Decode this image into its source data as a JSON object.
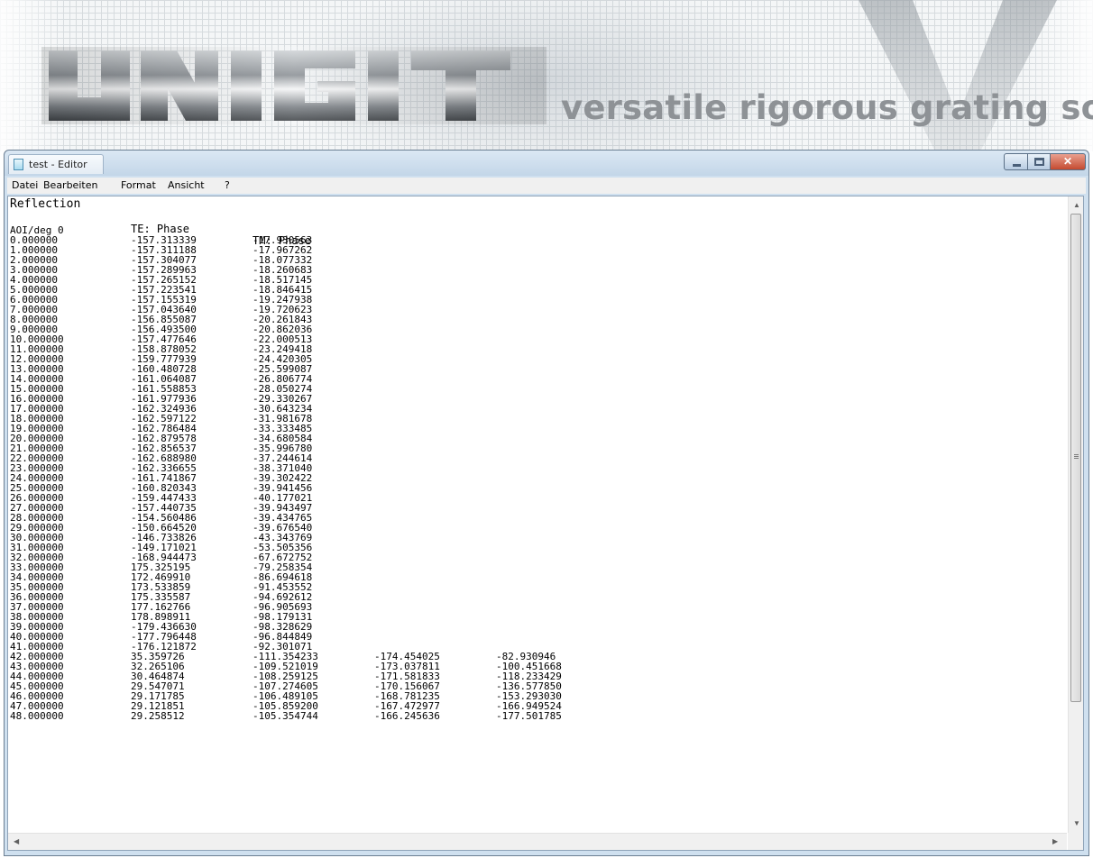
{
  "banner": {
    "logo_text": "UNIGIT",
    "tagline": "versatile rigorous grating solver"
  },
  "window": {
    "title": "test - Editor",
    "app_icon": "notepad-icon",
    "controls": {
      "minimize_icon": "minimize-icon",
      "maximize_icon": "maximize-icon",
      "close_icon": "close-icon"
    }
  },
  "menu": {
    "items": [
      "Datei",
      "Bearbeiten",
      "Format",
      "Ansicht",
      "?"
    ]
  },
  "document": {
    "title_line": "Reflection",
    "header": [
      "",
      "TE: Phase",
      "TM: Phase"
    ],
    "subheader": "AOI/deg 0",
    "rows": [
      [
        "0.000000",
        "-157.313339",
        "-17.930563"
      ],
      [
        "1.000000",
        "-157.311188",
        "-17.967262"
      ],
      [
        "2.000000",
        "-157.304077",
        "-18.077332"
      ],
      [
        "3.000000",
        "-157.289963",
        "-18.260683"
      ],
      [
        "4.000000",
        "-157.265152",
        "-18.517145"
      ],
      [
        "5.000000",
        "-157.223541",
        "-18.846415"
      ],
      [
        "6.000000",
        "-157.155319",
        "-19.247938"
      ],
      [
        "7.000000",
        "-157.043640",
        "-19.720623"
      ],
      [
        "8.000000",
        "-156.855087",
        "-20.261843"
      ],
      [
        "9.000000",
        "-156.493500",
        "-20.862036"
      ],
      [
        "10.000000",
        "-157.477646",
        "-22.000513"
      ],
      [
        "11.000000",
        "-158.878052",
        "-23.249418"
      ],
      [
        "12.000000",
        "-159.777939",
        "-24.420305"
      ],
      [
        "13.000000",
        "-160.480728",
        "-25.599087"
      ],
      [
        "14.000000",
        "-161.064087",
        "-26.806774"
      ],
      [
        "15.000000",
        "-161.558853",
        "-28.050274"
      ],
      [
        "16.000000",
        "-161.977936",
        "-29.330267"
      ],
      [
        "17.000000",
        "-162.324936",
        "-30.643234"
      ],
      [
        "18.000000",
        "-162.597122",
        "-31.981678"
      ],
      [
        "19.000000",
        "-162.786484",
        "-33.333485"
      ],
      [
        "20.000000",
        "-162.879578",
        "-34.680584"
      ],
      [
        "21.000000",
        "-162.856537",
        "-35.996780"
      ],
      [
        "22.000000",
        "-162.688980",
        "-37.244614"
      ],
      [
        "23.000000",
        "-162.336655",
        "-38.371040"
      ],
      [
        "24.000000",
        "-161.741867",
        "-39.302422"
      ],
      [
        "25.000000",
        "-160.820343",
        "-39.941456"
      ],
      [
        "26.000000",
        "-159.447433",
        "-40.177021"
      ],
      [
        "27.000000",
        "-157.440735",
        "-39.943497"
      ],
      [
        "28.000000",
        "-154.560486",
        "-39.434765"
      ],
      [
        "29.000000",
        "-150.664520",
        "-39.676540"
      ],
      [
        "30.000000",
        "-146.733826",
        "-43.343769"
      ],
      [
        "31.000000",
        "-149.171021",
        "-53.505356"
      ],
      [
        "32.000000",
        "-168.944473",
        "-67.672752"
      ],
      [
        "33.000000",
        "175.325195",
        "-79.258354"
      ],
      [
        "34.000000",
        "172.469910",
        "-86.694618"
      ],
      [
        "35.000000",
        "173.533859",
        "-91.453552"
      ],
      [
        "36.000000",
        "175.335587",
        "-94.692612"
      ],
      [
        "37.000000",
        "177.162766",
        "-96.905693"
      ],
      [
        "38.000000",
        "178.898911",
        "-98.179131"
      ],
      [
        "39.000000",
        "-179.436630",
        "-98.328629"
      ],
      [
        "40.000000",
        "-177.796448",
        "-96.844849"
      ],
      [
        "41.000000",
        "-176.121872",
        "-92.301071"
      ],
      [
        "42.000000",
        "35.359726",
        "-111.354233",
        "-174.454025",
        "-82.930946"
      ],
      [
        "43.000000",
        "32.265106",
        "-109.521019",
        "-173.037811",
        "-100.451668"
      ],
      [
        "44.000000",
        "30.464874",
        "-108.259125",
        "-171.581833",
        "-118.233429"
      ],
      [
        "45.000000",
        "29.547071",
        "-107.274605",
        "-170.156067",
        "-136.577850"
      ],
      [
        "46.000000",
        "29.171785",
        "-106.489105",
        "-168.781235",
        "-153.293030"
      ],
      [
        "47.000000",
        "29.121851",
        "-105.859200",
        "-167.472977",
        "-166.949524"
      ],
      [
        "48.000000",
        "29.258512",
        "-105.354744",
        "-166.245636",
        "-177.501785"
      ]
    ]
  },
  "scrollbars": {
    "vertical_position": 0.0,
    "up_icon": "scroll-up-arrow-icon",
    "down_icon": "scroll-down-arrow-icon",
    "left_icon": "scroll-left-arrow-icon",
    "right_icon": "scroll-right-arrow-icon"
  },
  "colors": {
    "tagline": "#8e9296",
    "close_button": "#c44a30",
    "window_frame": "#cfe0ef"
  }
}
